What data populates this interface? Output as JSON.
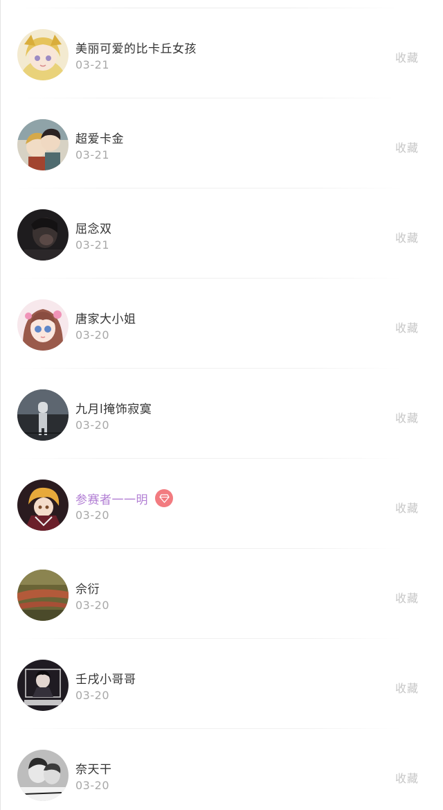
{
  "favorite_label": "收藏",
  "users": [
    {
      "name": "美丽可爱的比卡丘女孩",
      "date": "03-21",
      "vip": false
    },
    {
      "name": "超爱卡金",
      "date": "03-21",
      "vip": false
    },
    {
      "name": "屈念双",
      "date": "03-21",
      "vip": false
    },
    {
      "name": "唐家大小姐",
      "date": "03-20",
      "vip": false
    },
    {
      "name": "九月l掩饰寂寞",
      "date": "03-20",
      "vip": false
    },
    {
      "name": "参赛者一一明",
      "date": "03-20",
      "vip": true
    },
    {
      "name": "佘衍",
      "date": "03-20",
      "vip": false
    },
    {
      "name": "壬戌小哥哥",
      "date": "03-20",
      "vip": false
    },
    {
      "name": "奈天干",
      "date": "03-20",
      "vip": false
    }
  ],
  "colors": {
    "name_text": "#333333",
    "vip_name_text": "#b27fd4",
    "date_text": "#a8a8a8",
    "favorite_text": "#c6c6c6",
    "diamond_badge": "#f27b80"
  },
  "icons": {
    "vip_badge": "diamond-icon"
  }
}
